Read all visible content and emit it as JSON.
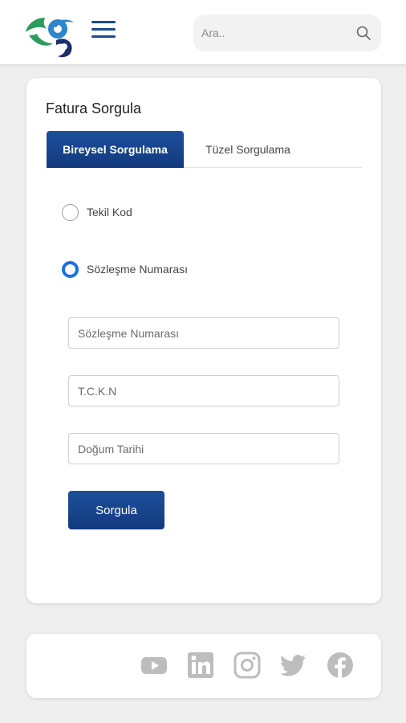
{
  "header": {
    "search_placeholder": "Ara..",
    "logo_icon": "company-logo",
    "menu_icon": "hamburger-menu-icon",
    "search_icon": "search-icon"
  },
  "card": {
    "title": "Fatura Sorgula",
    "tabs": [
      {
        "label": "Bireysel Sorgulama",
        "active": true
      },
      {
        "label": "Tüzel Sorgulama",
        "active": false
      }
    ],
    "radio_options": [
      {
        "label": "Tekil Kod",
        "checked": false
      },
      {
        "label": "Sözleşme Numarası",
        "checked": true
      }
    ],
    "fields": [
      {
        "placeholder": "Sözleşme Numarası",
        "value": ""
      },
      {
        "placeholder": "T.C.K.N",
        "value": ""
      },
      {
        "placeholder": "Doğum Tarihi",
        "value": ""
      }
    ],
    "submit_label": "Sorgula"
  },
  "footer": {
    "social_icons": [
      "youtube-icon",
      "linkedin-icon",
      "instagram-icon",
      "twitter-icon",
      "facebook-icon"
    ]
  },
  "colors": {
    "primary": "#123a7d",
    "radio_active": "#1a6fe6",
    "logo_green": "#2e9a5c",
    "logo_blue": "#2f85c9",
    "logo_navy": "#1c2f6b",
    "social_gray": "#bdbdbd",
    "background": "#efefef"
  }
}
